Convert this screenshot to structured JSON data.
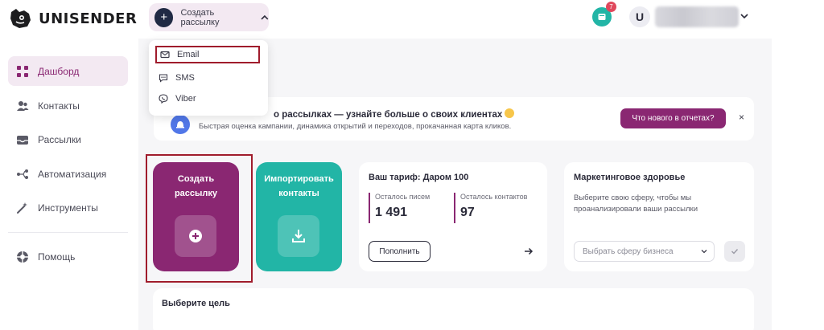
{
  "app": {
    "brand": "UNISENDER"
  },
  "sidebar": {
    "items": [
      {
        "label": "Дашборд",
        "icon": "grid-icon",
        "active": true
      },
      {
        "label": "Контакты",
        "icon": "users-icon"
      },
      {
        "label": "Рассылки",
        "icon": "mailbox-icon"
      },
      {
        "label": "Автоматизация",
        "icon": "flow-icon"
      },
      {
        "label": "Инструменты",
        "icon": "magic-wand-icon"
      }
    ],
    "help": {
      "label": "Помощь",
      "icon": "lifebuoy-icon"
    }
  },
  "topbar": {
    "create_label": "Создать рассылку",
    "notifications_count": "7",
    "avatar_letter": "U"
  },
  "dropdown": {
    "items": [
      {
        "label": "Email",
        "icon": "envelope-icon"
      },
      {
        "label": "SMS",
        "icon": "sms-icon"
      },
      {
        "label": "Viber",
        "icon": "viber-icon"
      }
    ]
  },
  "banner": {
    "title": "о рассылках — узнайте больше о своих клиентах",
    "subtitle": "Быстрая оценка кампании, динамика открытий и переходов, прокачанная карта кликов.",
    "button": "Что нового в отчетах?",
    "close": "×"
  },
  "tiles": {
    "create": "Создать рассылку",
    "import": "Импортировать контакты"
  },
  "tariff": {
    "title": "Ваш тариф: Даром 100",
    "letters_label": "Осталось писем",
    "letters_value": "1 491",
    "contacts_label": "Осталось контактов",
    "contacts_value": "97",
    "topup_button": "Пополнить"
  },
  "health": {
    "title": "Маркетинговое здоровье",
    "description": "Выберите свою сферу, чтобы мы проанализировали ваши рассылки",
    "select_placeholder": "Выбрать сферу бизнеса"
  },
  "goal": {
    "title": "Выберите цель"
  },
  "colors": {
    "accent": "#8a2772",
    "teal": "#22b5a6",
    "highlight": "#a01c2c"
  }
}
